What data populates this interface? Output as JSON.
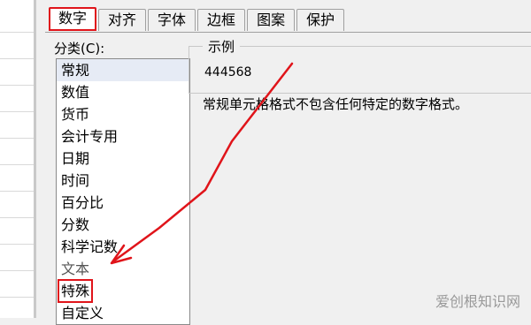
{
  "tabs": [
    "数字",
    "对齐",
    "字体",
    "边框",
    "图案",
    "保护"
  ],
  "active_tab": "数字",
  "category_label": "分类(C):",
  "categories": [
    {
      "label": "常规",
      "selected": true
    },
    {
      "label": "数值"
    },
    {
      "label": "货币"
    },
    {
      "label": "会计专用"
    },
    {
      "label": "日期"
    },
    {
      "label": "时间"
    },
    {
      "label": "百分比"
    },
    {
      "label": "分数"
    },
    {
      "label": "科学记数"
    },
    {
      "label": "文本"
    },
    {
      "label": "特殊",
      "highlighted": true
    },
    {
      "label": "自定义"
    }
  ],
  "example": {
    "title": "示例",
    "value": "444568"
  },
  "description": "常规单元格格式不包含任何特定的数字格式。",
  "watermark": "爱创根知识网",
  "annotation_color": "#e0141a"
}
